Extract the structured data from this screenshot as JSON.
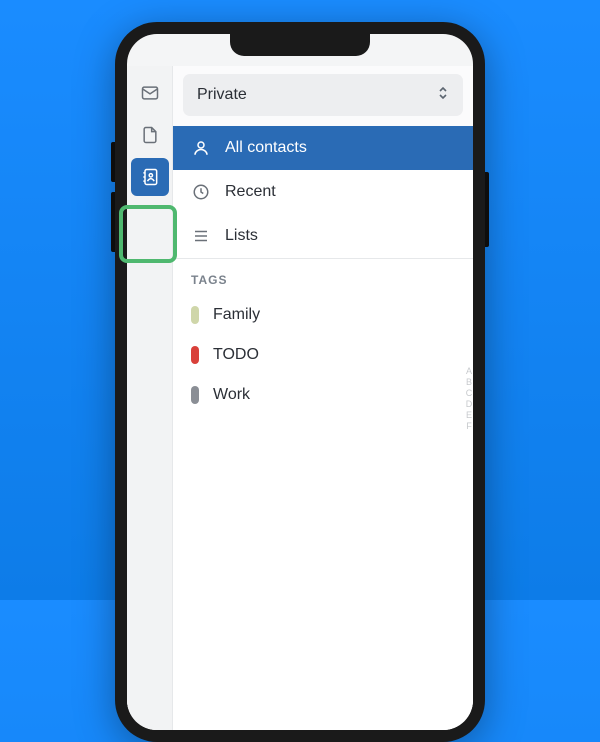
{
  "colors": {
    "accent": "#2a6bb5",
    "highlight_border": "#4fb86f"
  },
  "selector": {
    "value": "Private"
  },
  "sections": [
    {
      "id": "all",
      "label": "All contacts",
      "icon": "person",
      "selected": true
    },
    {
      "id": "recent",
      "label": "Recent",
      "icon": "clock",
      "selected": false
    },
    {
      "id": "lists",
      "label": "Lists",
      "icon": "list",
      "selected": false
    }
  ],
  "tags_header": "TAGS",
  "tags": [
    {
      "label": "Family",
      "color": "#cfd6a9"
    },
    {
      "label": "TODO",
      "color": "#d9403a"
    },
    {
      "label": "Work",
      "color": "#8a8e95"
    }
  ]
}
